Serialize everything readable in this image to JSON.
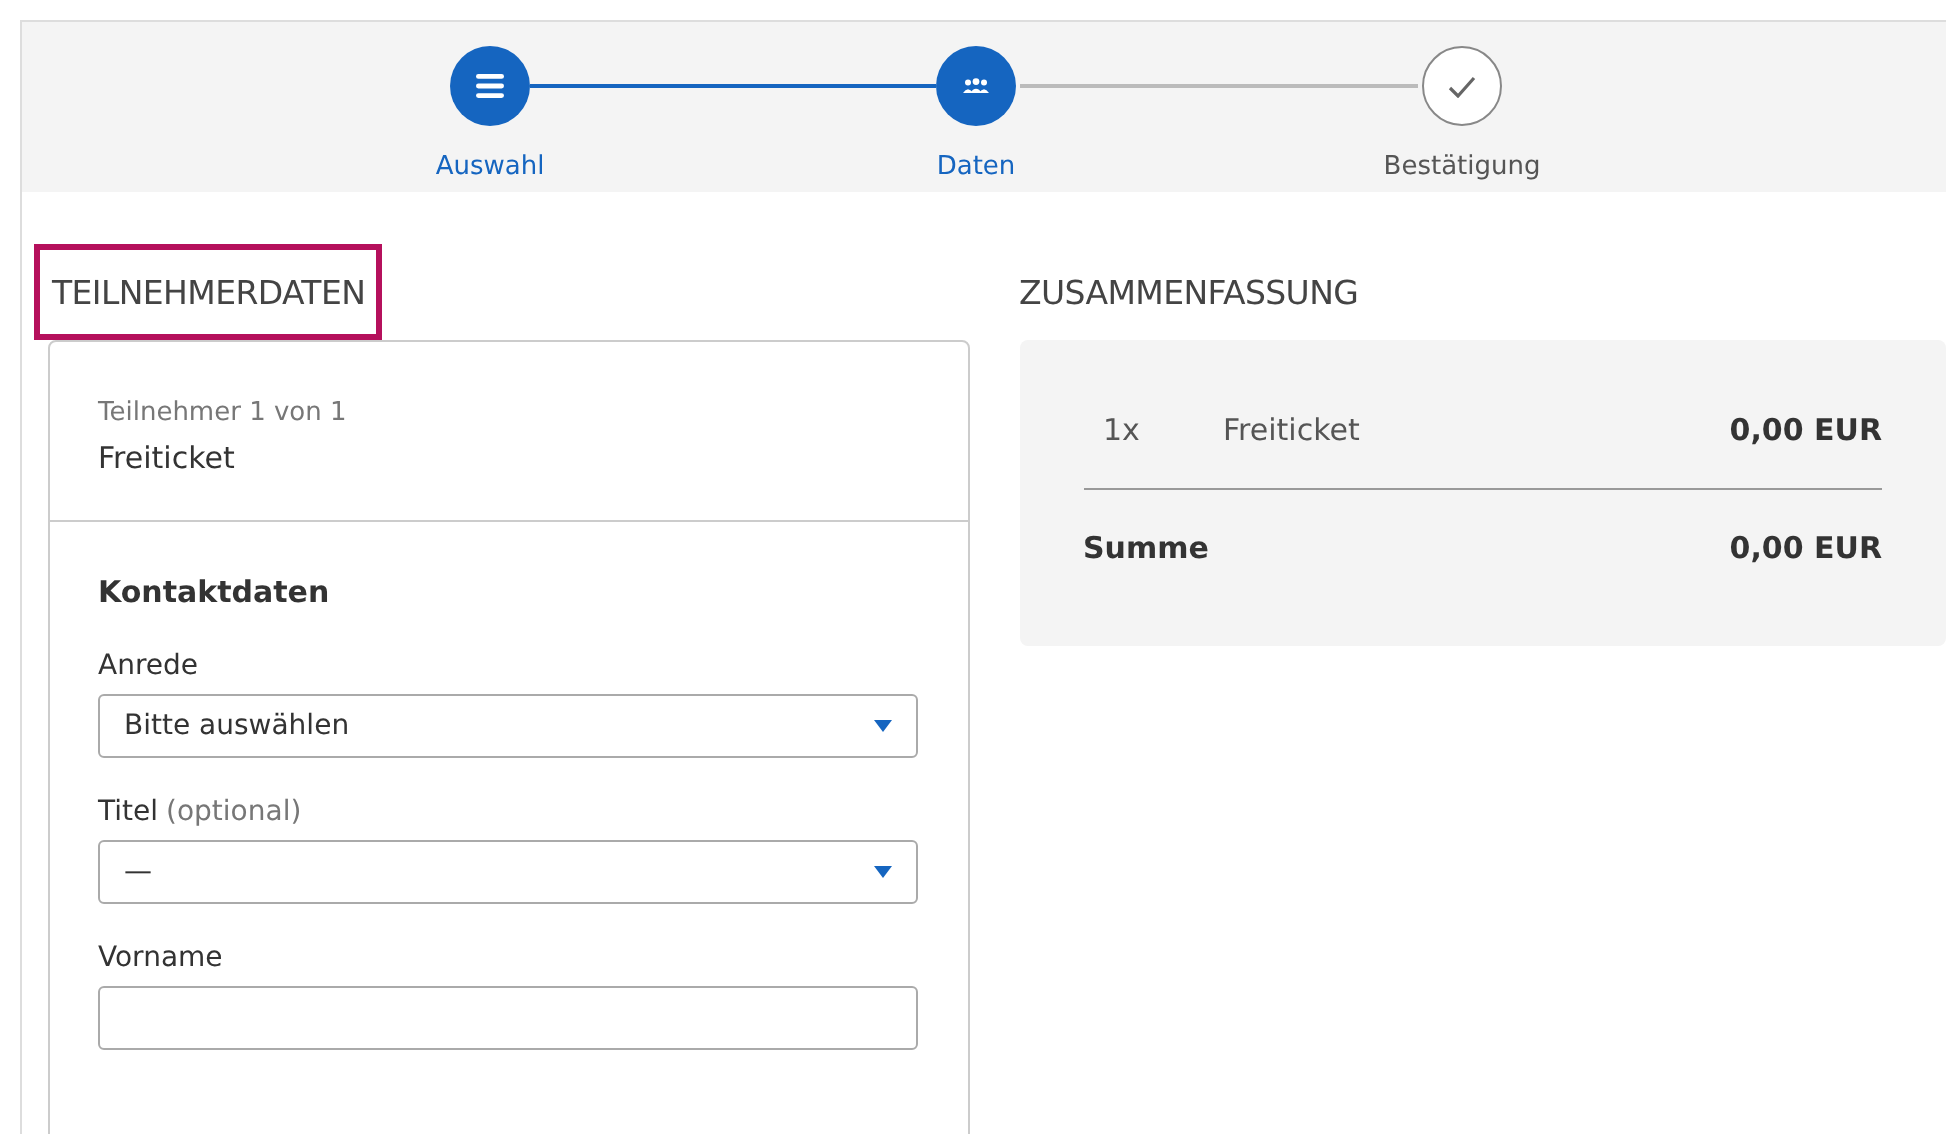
{
  "steps": [
    {
      "label": "Auswahl",
      "reached": true
    },
    {
      "label": "Daten",
      "reached": true
    },
    {
      "label": "Bestätigung",
      "reached": false
    }
  ],
  "participant_section": {
    "heading": "TEILNEHMERDATEN",
    "highlighted": true,
    "counter": "Teilnehmer 1 von 1",
    "ticket": "Freiticket",
    "group_title": "Kontaktdaten",
    "fields": [
      {
        "kind": "select",
        "label": "Anrede",
        "value": "Bitte auswählen"
      },
      {
        "kind": "select",
        "label": "Titel",
        "hint": "(optional)",
        "value": "—"
      },
      {
        "kind": "text",
        "label": "Vorname"
      }
    ]
  },
  "summary": {
    "heading": "ZUSAMMENFASSUNG",
    "items": [
      {
        "quantity": "1x",
        "name": "Freiticket",
        "price": "0,00 EUR"
      }
    ],
    "total_label": "Summe",
    "total": "0,00 EUR"
  }
}
